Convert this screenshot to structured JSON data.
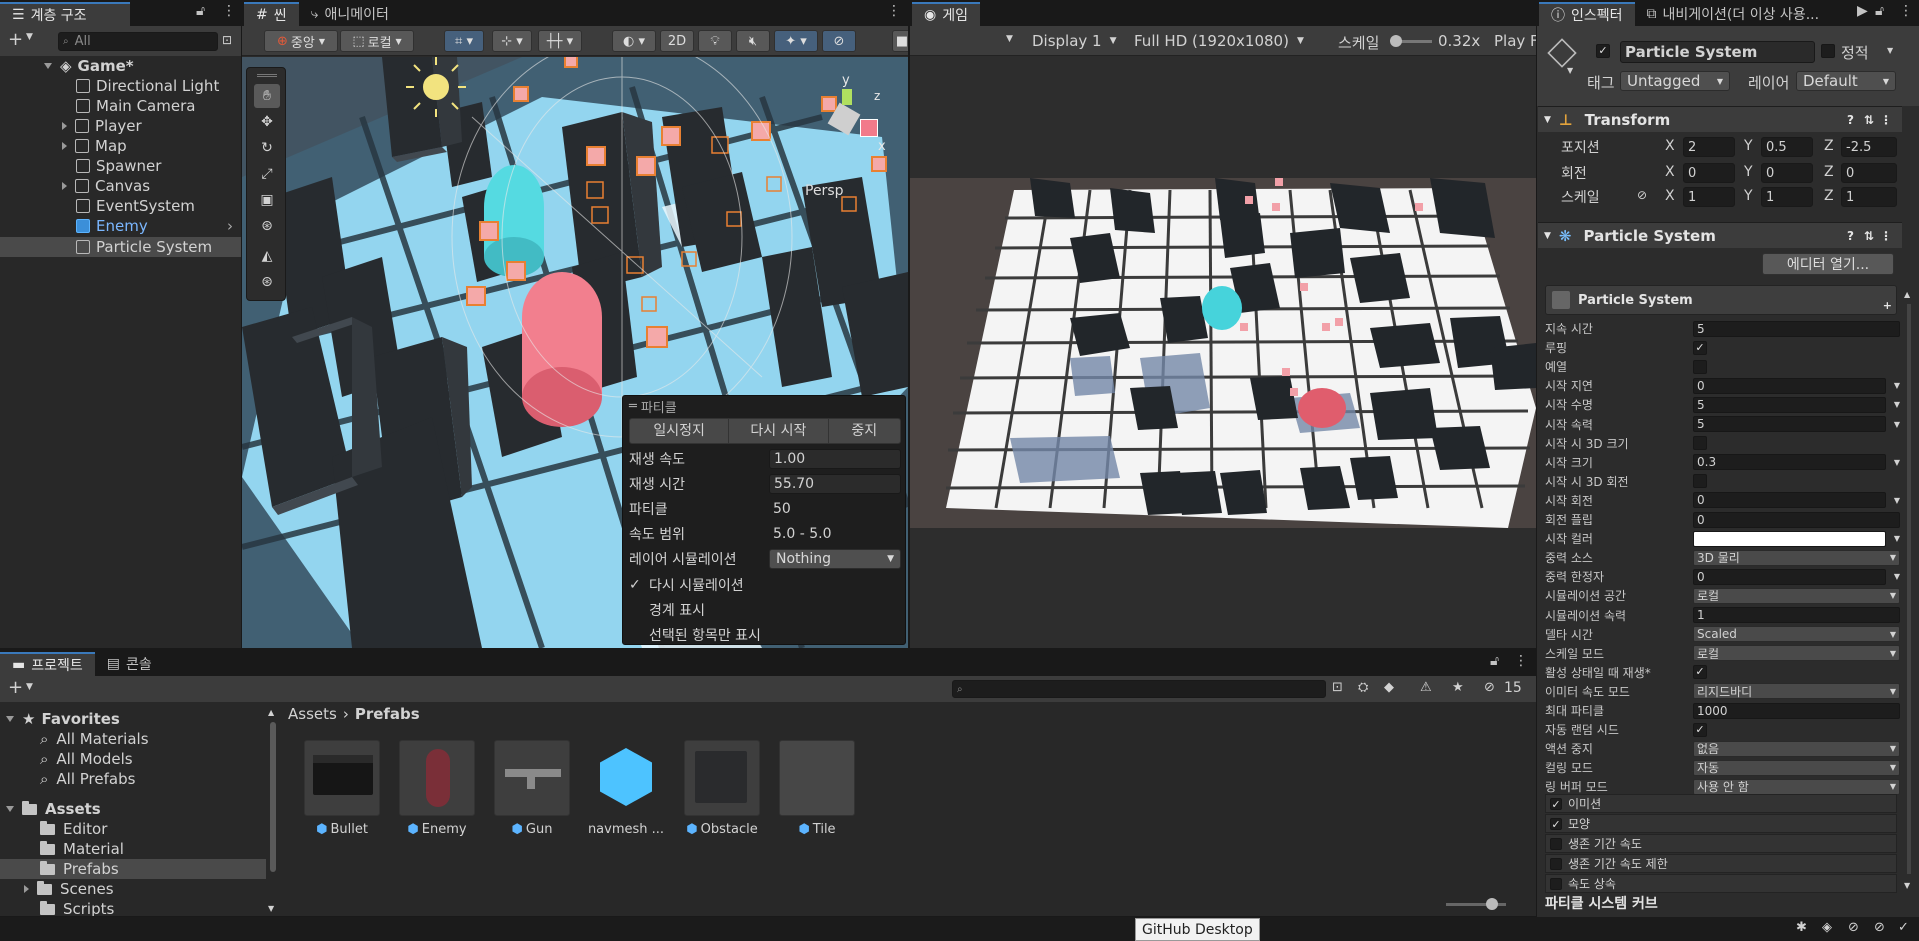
{
  "hierarchy": {
    "tab_label": "계층 구조",
    "search_placeholder": "All",
    "scene_name": "Game*",
    "items": [
      {
        "label": "Directional Light"
      },
      {
        "label": "Main Camera"
      },
      {
        "label": "Player"
      },
      {
        "label": "Map"
      },
      {
        "label": "Spawner"
      },
      {
        "label": "Canvas"
      },
      {
        "label": "EventSystem"
      },
      {
        "label": "Enemy"
      },
      {
        "label": "Particle System"
      }
    ]
  },
  "scene": {
    "tab_label": "씬",
    "anim_tab_label": "애니메이터",
    "pivot_label": "중앙",
    "space_label": "로컬",
    "mode_2d": "2D",
    "persp_label": "Persp",
    "gizmo_y": "y",
    "gizmo_x": "x",
    "gizmo_z": "z",
    "particle_overlay": {
      "title": "파티클",
      "pause_button": "일시정지",
      "restart_button": "다시 시작",
      "stop_button": "중지",
      "rows": [
        {
          "label": "재생 속도",
          "value": "1.00"
        },
        {
          "label": "재생 시간",
          "value": "55.70"
        },
        {
          "label": "파티클",
          "value": "50"
        },
        {
          "label": "속도 범위",
          "value": "5.0 - 5.0"
        }
      ],
      "layer_sim_label": "레이어 시뮬레이션",
      "layer_sim_value": "Nothing",
      "checks": [
        {
          "label": "다시 시뮬레이션",
          "checked": true
        },
        {
          "label": "경계 표시",
          "checked": false
        },
        {
          "label": "선택된 항목만 표시",
          "checked": false
        }
      ]
    }
  },
  "game": {
    "tab_label": "게임",
    "display": "Display 1",
    "resolution": "Full HD (1920x1080)",
    "scale_label": "스케일",
    "scale_value": "0.32x",
    "play_label": "Play F"
  },
  "inspector": {
    "tab_label": "인스펙터",
    "nav_tab_label": "내비게이션(더 이상 사용...",
    "object_name": "Particle System",
    "static_label": "정적",
    "tag_label": "태그",
    "tag_value": "Untagged",
    "layer_label": "레이어",
    "layer_value": "Default",
    "transform_title": "Transform",
    "position_label": "포지션",
    "rotation_label": "회전",
    "scale_label": "스케일",
    "position": {
      "x": "2",
      "y": "0.5",
      "z": "-2.5"
    },
    "rotation": {
      "x": "0",
      "y": "0",
      "z": "0"
    },
    "scale": {
      "x": "1",
      "y": "1",
      "z": "1"
    },
    "ps_title": "Particle System",
    "open_editor": "에디터 열기...",
    "ps_module_title": "Particle System",
    "rows": [
      {
        "label": "지속 시간",
        "value": "5",
        "kind": "field"
      },
      {
        "label": "루핑",
        "value": "✓",
        "kind": "check"
      },
      {
        "label": "예열",
        "value": "",
        "kind": "check"
      },
      {
        "label": "시작 지연",
        "value": "0",
        "kind": "curve"
      },
      {
        "label": "시작 수명",
        "value": "5",
        "kind": "curve"
      },
      {
        "label": "시작 속력",
        "value": "5",
        "kind": "curve"
      },
      {
        "label": "시작 시 3D 크기",
        "value": "",
        "kind": "check"
      },
      {
        "label": "시작 크기",
        "value": "0.3",
        "kind": "curve"
      },
      {
        "label": "시작 시 3D 회전",
        "value": "",
        "kind": "check"
      },
      {
        "label": "시작 회전",
        "value": "0",
        "kind": "curve"
      },
      {
        "label": "회전 플립",
        "value": "0",
        "kind": "field"
      },
      {
        "label": "시작 컬러",
        "value": "",
        "kind": "color"
      },
      {
        "label": "중력 소스",
        "value": "3D 물리",
        "kind": "drop"
      },
      {
        "label": "중력 한정자",
        "value": "0",
        "kind": "curve"
      },
      {
        "label": "시뮬레이션 공간",
        "value": "로컬",
        "kind": "drop"
      },
      {
        "label": "시뮬레이션 속력",
        "value": "1",
        "kind": "field"
      },
      {
        "label": "델타 시간",
        "value": "Scaled",
        "kind": "drop"
      },
      {
        "label": "스케일 모드",
        "value": "로컬",
        "kind": "drop"
      },
      {
        "label": "활성 상태일 때 재생*",
        "value": "✓",
        "kind": "check"
      },
      {
        "label": "이미터 속도 모드",
        "value": "리지드바디",
        "kind": "drop"
      },
      {
        "label": "최대 파티클",
        "value": "1000",
        "kind": "field"
      },
      {
        "label": "자동 랜덤 시드",
        "value": "✓",
        "kind": "check"
      },
      {
        "label": "액션 중지",
        "value": "없음",
        "kind": "drop"
      },
      {
        "label": "컬링 모드",
        "value": "자동",
        "kind": "drop"
      },
      {
        "label": "링 버퍼 모드",
        "value": "사용 안 함",
        "kind": "drop"
      }
    ],
    "modules": [
      {
        "label": "이미션",
        "checked": true
      },
      {
        "label": "모양",
        "checked": true
      },
      {
        "label": "생존 기간 속도",
        "checked": false
      },
      {
        "label": "생존 기간 속도 제한",
        "checked": false
      },
      {
        "label": "속도 상속",
        "checked": false
      }
    ],
    "curves_label": "파티클 시스템 커브"
  },
  "project": {
    "tab_label": "프로젝트",
    "console_tab_label": "콘솔",
    "hidden_count": "15",
    "favorites_label": "Favorites",
    "favorites": [
      "All Materials",
      "All Models",
      "All Prefabs"
    ],
    "assets_label": "Assets",
    "folders": [
      "Editor",
      "Material",
      "Prefabs",
      "Scenes",
      "Scripts"
    ],
    "breadcrumb_root": "Assets",
    "breadcrumb_current": "Prefabs",
    "assets": [
      {
        "label": "Bullet"
      },
      {
        "label": "Enemy"
      },
      {
        "label": "Gun"
      },
      {
        "label": "navmesh ..."
      },
      {
        "label": "Obstacle"
      },
      {
        "label": "Tile"
      }
    ]
  },
  "tooltip": "GitHub Desktop"
}
